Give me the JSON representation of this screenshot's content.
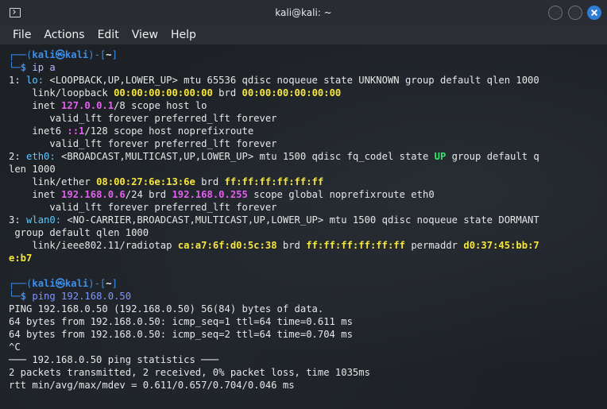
{
  "window": {
    "title": "kali@kali: ~",
    "accent": "#2d7dd6"
  },
  "menu": [
    "File",
    "Actions",
    "Edit",
    "View",
    "Help"
  ],
  "prompt1": {
    "top_prefix": "┌──(",
    "user": "kali㉿kali",
    "top_mid": ")-[",
    "dir": "~",
    "top_suffix": "]",
    "bottom_prefix": "└─",
    "symbol": "$",
    "command": " ip a"
  },
  "ip_output": {
    "l1_a": "1: ",
    "l1_iface": "lo:",
    "l1_b": " <LOOPBACK,UP,LOWER_UP> mtu 65536 qdisc noqueue state UNKNOWN group default qlen 1000",
    "l2_a": "    link/loopback ",
    "l2_mac": "00:00:00:00:00:00",
    "l2_b": " brd ",
    "l2_brd": "00:00:00:00:00:00",
    "l3_a": "    inet ",
    "l3_ip": "127.0.0.1",
    "l3_b": "/8 scope host lo",
    "l4": "       valid_lft forever preferred_lft forever",
    "l5_a": "    inet6 ",
    "l5_ip": "::1",
    "l5_b": "/128 scope host noprefixroute",
    "l6": "       valid_lft forever preferred_lft forever",
    "l7_a": "2: ",
    "l7_iface": "eth0:",
    "l7_b": " <BROADCAST,MULTICAST,UP,LOWER_UP> mtu 1500 qdisc fq_codel state ",
    "l7_state": "UP",
    "l7_c": " group default q",
    "l8": "len 1000",
    "l9_a": "    link/ether ",
    "l9_mac": "08:00:27:6e:13:6e",
    "l9_b": " brd ",
    "l9_brd": "ff:ff:ff:ff:ff:ff",
    "l10_a": "    inet ",
    "l10_ip": "192.168.0.6",
    "l10_b": "/24 brd ",
    "l10_brd": "192.168.0.255",
    "l10_c": " scope global noprefixroute eth0",
    "l11": "       valid_lft forever preferred_lft forever",
    "l12_a": "3: ",
    "l12_iface": "wlan0:",
    "l12_b": " <NO-CARRIER,BROADCAST,MULTICAST,UP,LOWER_UP> mtu 1500 qdisc noqueue state DORMANT",
    "l13": " group default qlen 1000",
    "l14_a": "    link/ieee802.11/radiotap ",
    "l14_mac": "ca:a7:6f:d0:5c:38",
    "l14_b": " brd ",
    "l14_brd": "ff:ff:ff:ff:ff:ff",
    "l14_c": " permaddr ",
    "l14_perm": "d0:37:45:bb:7",
    "l15": "e:b7"
  },
  "prompt2": {
    "top_prefix": "┌──(",
    "user": "kali㉿kali",
    "top_mid": ")-[",
    "dir": "~",
    "top_suffix": "]",
    "bottom_prefix": "└─",
    "symbol": "$",
    "command_word": " ping",
    "command_arg": " 192.168.0.50"
  },
  "ping_output": [
    "PING 192.168.0.50 (192.168.0.50) 56(84) bytes of data.",
    "64 bytes from 192.168.0.50: icmp_seq=1 ttl=64 time=0.611 ms",
    "64 bytes from 192.168.0.50: icmp_seq=2 ttl=64 time=0.704 ms",
    "^C",
    "─── 192.168.0.50 ping statistics ───",
    "2 packets transmitted, 2 received, 0% packet loss, time 1035ms",
    "rtt min/avg/max/mdev = 0.611/0.657/0.704/0.046 ms"
  ]
}
